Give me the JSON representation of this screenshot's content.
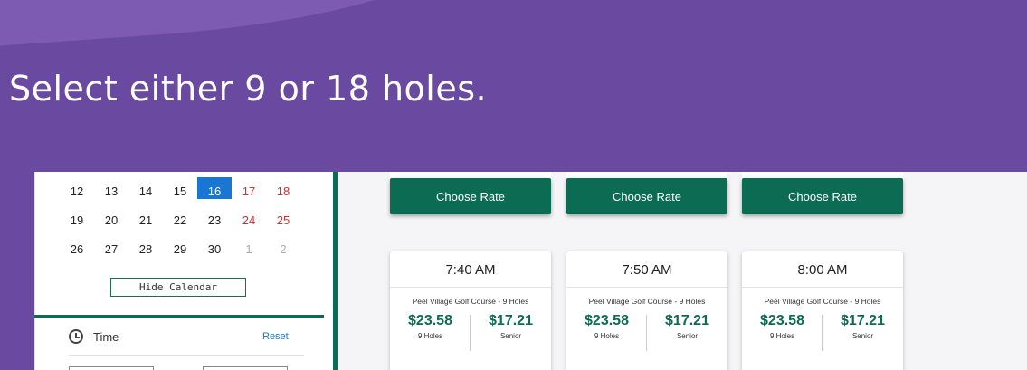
{
  "banner": {
    "title": "Select either 9 or 18 holes."
  },
  "calendar": {
    "weeks": [
      [
        {
          "d": "12",
          "t": ""
        },
        {
          "d": "13",
          "t": ""
        },
        {
          "d": "14",
          "t": ""
        },
        {
          "d": "15",
          "t": ""
        },
        {
          "d": "16",
          "t": "selected"
        },
        {
          "d": "17",
          "t": "weekend"
        },
        {
          "d": "18",
          "t": "weekend"
        }
      ],
      [
        {
          "d": "19",
          "t": ""
        },
        {
          "d": "20",
          "t": ""
        },
        {
          "d": "21",
          "t": ""
        },
        {
          "d": "22",
          "t": ""
        },
        {
          "d": "23",
          "t": ""
        },
        {
          "d": "24",
          "t": "weekend"
        },
        {
          "d": "25",
          "t": "weekend"
        }
      ],
      [
        {
          "d": "26",
          "t": ""
        },
        {
          "d": "27",
          "t": ""
        },
        {
          "d": "28",
          "t": ""
        },
        {
          "d": "29",
          "t": ""
        },
        {
          "d": "30",
          "t": ""
        },
        {
          "d": "1",
          "t": "muted"
        },
        {
          "d": "2",
          "t": "muted"
        }
      ]
    ],
    "hide_label": "Hide Calendar"
  },
  "time_filter": {
    "label": "Time",
    "reset_label": "Reset"
  },
  "top_cards": [
    {
      "button_label": "Choose Rate"
    },
    {
      "button_label": "Choose Rate"
    },
    {
      "button_label": "Choose Rate"
    }
  ],
  "tee_times": [
    {
      "time": "7:40 AM",
      "course": "Peel Village Golf Course - 9 Holes",
      "prices": [
        {
          "amount": "$23.58",
          "label": "9 Holes"
        },
        {
          "amount": "$17.21",
          "label": "Senior"
        }
      ]
    },
    {
      "time": "7:50 AM",
      "course": "Peel Village Golf Course - 9 Holes",
      "prices": [
        {
          "amount": "$23.58",
          "label": "9 Holes"
        },
        {
          "amount": "$17.21",
          "label": "Senior"
        }
      ]
    },
    {
      "time": "8:00 AM",
      "course": "Peel Village Golf Course - 9 Holes",
      "prices": [
        {
          "amount": "$23.58",
          "label": "9 Holes"
        },
        {
          "amount": "$17.21",
          "label": "Senior"
        }
      ]
    }
  ],
  "colors": {
    "banner": "#6a4aa0",
    "brand_green": "#0b6b53",
    "selected_day": "#1976d2",
    "weekend": "#d32f2f"
  }
}
